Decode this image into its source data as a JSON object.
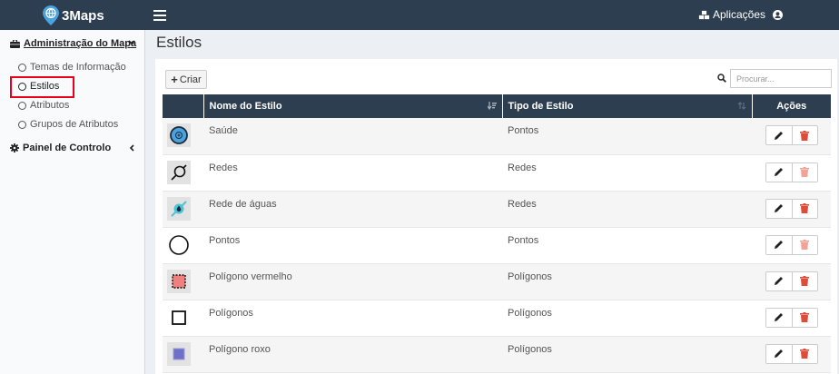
{
  "app": {
    "name": "3Maps"
  },
  "header": {
    "apps_label": "Aplicações"
  },
  "sidebar": {
    "section_admin": "Administração do Mapa",
    "items": [
      {
        "label": "Temas de Informação"
      },
      {
        "label": "Estilos"
      },
      {
        "label": "Atributos"
      },
      {
        "label": "Grupos de Atributos"
      }
    ],
    "section_control": "Painel de Controlo"
  },
  "page": {
    "title": "Estilos"
  },
  "toolbar": {
    "create_label": "Criar"
  },
  "search": {
    "placeholder": "Procurar..."
  },
  "table": {
    "columns": [
      "",
      "Nome do Estilo",
      "Tipo de Estilo",
      "Ações"
    ],
    "rows": [
      {
        "name": "Saúde",
        "type": "Pontos",
        "icon": "health-point-symbol",
        "delete_enabled": true
      },
      {
        "name": "Redes",
        "type": "Redes",
        "icon": "network-symbol",
        "delete_enabled": false
      },
      {
        "name": "Rede de águas",
        "type": "Redes",
        "icon": "water-network-symbol",
        "delete_enabled": true
      },
      {
        "name": "Pontos",
        "type": "Pontos",
        "icon": "point-circle-symbol",
        "delete_enabled": false
      },
      {
        "name": "Polígono vermelho",
        "type": "Polígonos",
        "icon": "red-polygon-symbol",
        "delete_enabled": true
      },
      {
        "name": "Polígonos",
        "type": "Polígonos",
        "icon": "polygon-outline-symbol",
        "delete_enabled": true
      },
      {
        "name": "Polígono roxo",
        "type": "Polígonos",
        "icon": "purple-polygon-symbol",
        "delete_enabled": true
      }
    ]
  },
  "colors": {
    "header_bg": "#2d3e50",
    "highlight": "#e8001c",
    "delete_red": "#dd4b39",
    "delete_disabled": "#f0a396",
    "logo_blue": "#4aa3df"
  }
}
